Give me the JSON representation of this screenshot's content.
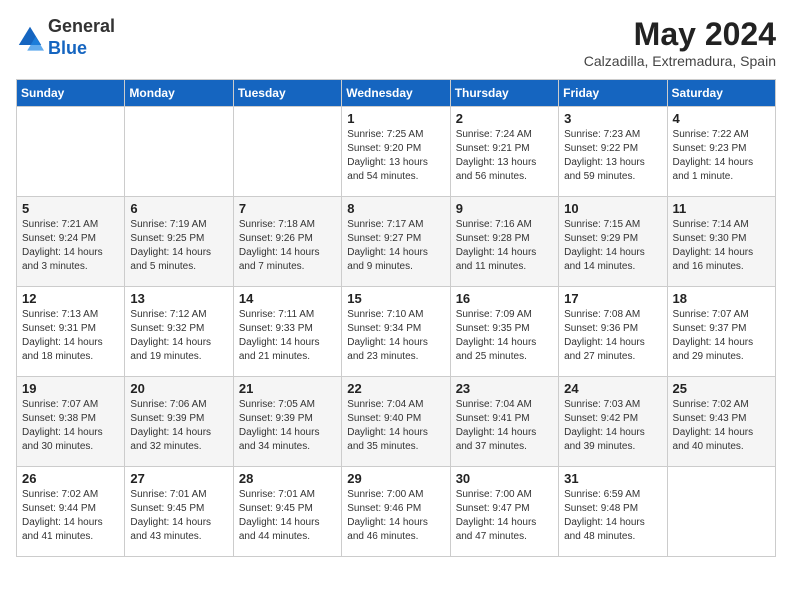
{
  "header": {
    "logo_general": "General",
    "logo_blue": "Blue",
    "month_title": "May 2024",
    "location": "Calzadilla, Extremadura, Spain"
  },
  "weekdays": [
    "Sunday",
    "Monday",
    "Tuesday",
    "Wednesday",
    "Thursday",
    "Friday",
    "Saturday"
  ],
  "weeks": [
    [
      {
        "day": "",
        "info": ""
      },
      {
        "day": "",
        "info": ""
      },
      {
        "day": "",
        "info": ""
      },
      {
        "day": "1",
        "info": "Sunrise: 7:25 AM\nSunset: 9:20 PM\nDaylight: 13 hours\nand 54 minutes."
      },
      {
        "day": "2",
        "info": "Sunrise: 7:24 AM\nSunset: 9:21 PM\nDaylight: 13 hours\nand 56 minutes."
      },
      {
        "day": "3",
        "info": "Sunrise: 7:23 AM\nSunset: 9:22 PM\nDaylight: 13 hours\nand 59 minutes."
      },
      {
        "day": "4",
        "info": "Sunrise: 7:22 AM\nSunset: 9:23 PM\nDaylight: 14 hours\nand 1 minute."
      }
    ],
    [
      {
        "day": "5",
        "info": "Sunrise: 7:21 AM\nSunset: 9:24 PM\nDaylight: 14 hours\nand 3 minutes."
      },
      {
        "day": "6",
        "info": "Sunrise: 7:19 AM\nSunset: 9:25 PM\nDaylight: 14 hours\nand 5 minutes."
      },
      {
        "day": "7",
        "info": "Sunrise: 7:18 AM\nSunset: 9:26 PM\nDaylight: 14 hours\nand 7 minutes."
      },
      {
        "day": "8",
        "info": "Sunrise: 7:17 AM\nSunset: 9:27 PM\nDaylight: 14 hours\nand 9 minutes."
      },
      {
        "day": "9",
        "info": "Sunrise: 7:16 AM\nSunset: 9:28 PM\nDaylight: 14 hours\nand 11 minutes."
      },
      {
        "day": "10",
        "info": "Sunrise: 7:15 AM\nSunset: 9:29 PM\nDaylight: 14 hours\nand 14 minutes."
      },
      {
        "day": "11",
        "info": "Sunrise: 7:14 AM\nSunset: 9:30 PM\nDaylight: 14 hours\nand 16 minutes."
      }
    ],
    [
      {
        "day": "12",
        "info": "Sunrise: 7:13 AM\nSunset: 9:31 PM\nDaylight: 14 hours\nand 18 minutes."
      },
      {
        "day": "13",
        "info": "Sunrise: 7:12 AM\nSunset: 9:32 PM\nDaylight: 14 hours\nand 19 minutes."
      },
      {
        "day": "14",
        "info": "Sunrise: 7:11 AM\nSunset: 9:33 PM\nDaylight: 14 hours\nand 21 minutes."
      },
      {
        "day": "15",
        "info": "Sunrise: 7:10 AM\nSunset: 9:34 PM\nDaylight: 14 hours\nand 23 minutes."
      },
      {
        "day": "16",
        "info": "Sunrise: 7:09 AM\nSunset: 9:35 PM\nDaylight: 14 hours\nand 25 minutes."
      },
      {
        "day": "17",
        "info": "Sunrise: 7:08 AM\nSunset: 9:36 PM\nDaylight: 14 hours\nand 27 minutes."
      },
      {
        "day": "18",
        "info": "Sunrise: 7:07 AM\nSunset: 9:37 PM\nDaylight: 14 hours\nand 29 minutes."
      }
    ],
    [
      {
        "day": "19",
        "info": "Sunrise: 7:07 AM\nSunset: 9:38 PM\nDaylight: 14 hours\nand 30 minutes."
      },
      {
        "day": "20",
        "info": "Sunrise: 7:06 AM\nSunset: 9:39 PM\nDaylight: 14 hours\nand 32 minutes."
      },
      {
        "day": "21",
        "info": "Sunrise: 7:05 AM\nSunset: 9:39 PM\nDaylight: 14 hours\nand 34 minutes."
      },
      {
        "day": "22",
        "info": "Sunrise: 7:04 AM\nSunset: 9:40 PM\nDaylight: 14 hours\nand 35 minutes."
      },
      {
        "day": "23",
        "info": "Sunrise: 7:04 AM\nSunset: 9:41 PM\nDaylight: 14 hours\nand 37 minutes."
      },
      {
        "day": "24",
        "info": "Sunrise: 7:03 AM\nSunset: 9:42 PM\nDaylight: 14 hours\nand 39 minutes."
      },
      {
        "day": "25",
        "info": "Sunrise: 7:02 AM\nSunset: 9:43 PM\nDaylight: 14 hours\nand 40 minutes."
      }
    ],
    [
      {
        "day": "26",
        "info": "Sunrise: 7:02 AM\nSunset: 9:44 PM\nDaylight: 14 hours\nand 41 minutes."
      },
      {
        "day": "27",
        "info": "Sunrise: 7:01 AM\nSunset: 9:45 PM\nDaylight: 14 hours\nand 43 minutes."
      },
      {
        "day": "28",
        "info": "Sunrise: 7:01 AM\nSunset: 9:45 PM\nDaylight: 14 hours\nand 44 minutes."
      },
      {
        "day": "29",
        "info": "Sunrise: 7:00 AM\nSunset: 9:46 PM\nDaylight: 14 hours\nand 46 minutes."
      },
      {
        "day": "30",
        "info": "Sunrise: 7:00 AM\nSunset: 9:47 PM\nDaylight: 14 hours\nand 47 minutes."
      },
      {
        "day": "31",
        "info": "Sunrise: 6:59 AM\nSunset: 9:48 PM\nDaylight: 14 hours\nand 48 minutes."
      },
      {
        "day": "",
        "info": ""
      }
    ]
  ]
}
